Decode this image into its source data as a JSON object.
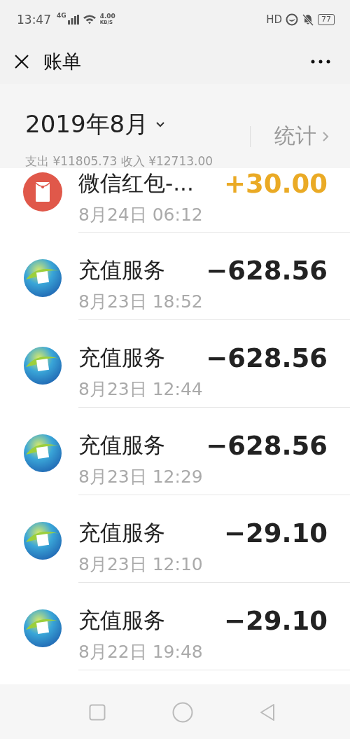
{
  "status_bar": {
    "time": "13:47",
    "network": "4G",
    "speed_value": "4.00",
    "speed_unit": "KB/S",
    "hd": "HD",
    "battery": "77"
  },
  "nav": {
    "title": "账单"
  },
  "header": {
    "month": "2019年8月",
    "stats": "统计",
    "summary": "支出 ¥11805.73 收入 ¥12713.00"
  },
  "transactions": [
    {
      "kind": "red_packet",
      "title": "微信红包-...",
      "amount": "+30.00",
      "income": true,
      "time": "8月24日 06:12"
    },
    {
      "kind": "recharge",
      "title": "充值服务",
      "amount": "−628.56",
      "income": false,
      "time": "8月23日 18:52"
    },
    {
      "kind": "recharge",
      "title": "充值服务",
      "amount": "−628.56",
      "income": false,
      "time": "8月23日 12:44"
    },
    {
      "kind": "recharge",
      "title": "充值服务",
      "amount": "−628.56",
      "income": false,
      "time": "8月23日 12:29"
    },
    {
      "kind": "recharge",
      "title": "充值服务",
      "amount": "−29.10",
      "income": false,
      "time": "8月23日 12:10"
    },
    {
      "kind": "recharge",
      "title": "充值服务",
      "amount": "−29.10",
      "income": false,
      "time": "8月22日 19:48"
    }
  ]
}
